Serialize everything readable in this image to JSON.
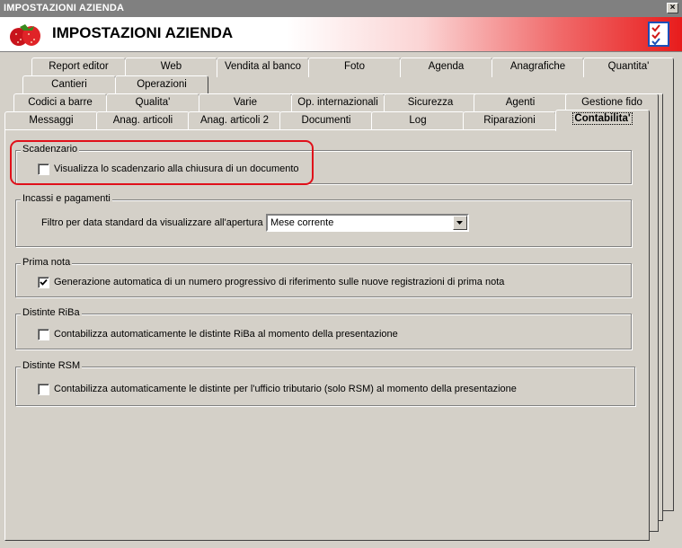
{
  "window": {
    "title": "IMPOSTAZIONI AZIENDA",
    "close_label": "×"
  },
  "banner": {
    "heading": "IMPOSTAZIONI AZIENDA",
    "logo_icon": "strawberry-icon",
    "checklist_icon": "checklist-icon"
  },
  "tabs": {
    "row1": [
      "Report editor",
      "Web",
      "Vendita al banco",
      "Foto",
      "Agenda",
      "Anagrafiche",
      "Quantita'"
    ],
    "row2": [
      "Cantieri",
      "Operazioni"
    ],
    "row3": [
      "Codici a barre",
      "Qualita'",
      "Varie",
      "Op. internazionali",
      "Sicurezza",
      "Agenti",
      "Gestione fido"
    ],
    "row4": [
      "Messaggi",
      "Anag. articoli",
      "Anag. articoli 2",
      "Documenti",
      "Log",
      "Riparazioni",
      "Contabilita'"
    ],
    "active": "Contabilita'"
  },
  "groups": {
    "scadenzario": {
      "title": "Scadenzario",
      "option": {
        "label": "Visualizza lo scadenzario alla chiusura di un documento",
        "checked": false
      }
    },
    "incassi": {
      "title": "Incassi e pagamenti",
      "filter_label": "Filtro per data standard da visualizzare all'apertura :",
      "filter_value": "Mese corrente"
    },
    "prima_nota": {
      "title": "Prima nota",
      "option": {
        "label": "Generazione automatica di un numero progressivo di riferimento sulle nuove registrazioni di prima nota",
        "checked": true
      }
    },
    "riba": {
      "title": "Distinte RiBa",
      "option": {
        "label": "Contabilizza automaticamente le distinte RiBa al momento della presentazione",
        "checked": false
      }
    },
    "rsm": {
      "title": "Distinte RSM",
      "option": {
        "label": "Contabilizza automaticamente le distinte per l'ufficio tributario (solo RSM) al momento della presentazione",
        "checked": false
      }
    }
  },
  "colors": {
    "highlight": "#e0101a",
    "banner_gradient_end": "#e81c1c",
    "face": "#d4d0c8"
  }
}
